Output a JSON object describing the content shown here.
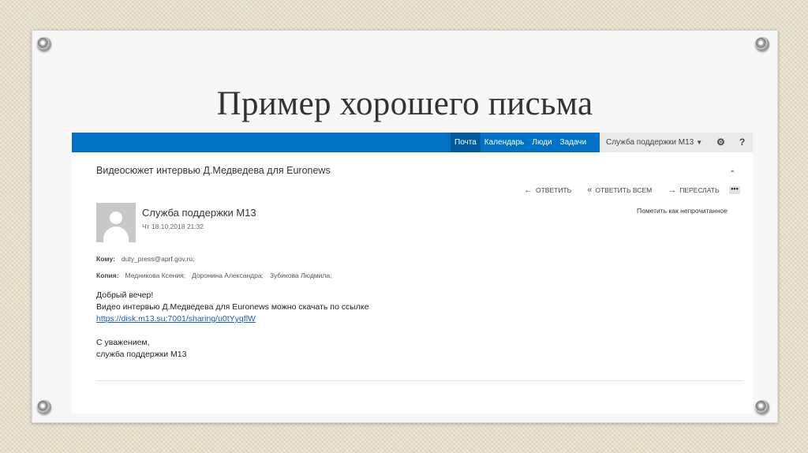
{
  "slide": {
    "title": "Пример хорошего письма"
  },
  "nav": {
    "items": [
      "Почта",
      "Календарь",
      "Люди",
      "Задачи"
    ]
  },
  "user": {
    "name": "Служба поддержки М13"
  },
  "toolbar": {
    "settings_icon": "gear-icon",
    "help_label": "?"
  },
  "email": {
    "subject": "Видеосюжет интервью Д.Медведева для Euronews",
    "actions": {
      "reply": "ОТВЕТИТЬ",
      "reply_all": "ОТВЕТИТЬ ВСЕМ",
      "forward": "ПЕРЕСЛАТЬ"
    },
    "more": "•••",
    "sender": "Служба поддержки М13",
    "date": "Чт 18.10.2018 21:32",
    "mark_unread": "Пометить как непрочитанное",
    "to_label": "Кому:",
    "to": "duty_press@aprf.gov.ru;",
    "cc_label": "Копия:",
    "cc": [
      "Медникова Ксения;",
      "Доронина Александра;",
      "Зубикова Людмила;"
    ],
    "greeting": "Добрый вечер!",
    "body_line": "Видео интервью Д.Медведева для Euronews можно скачать по ссылке",
    "link": "https://disk.m13.su:7001/sharing/u0tYyqflW",
    "closing": "С уважением,",
    "signature": "служба поддержки М13"
  },
  "colors": {
    "topbar": "#0072c6",
    "link": "#1a5fb4"
  }
}
